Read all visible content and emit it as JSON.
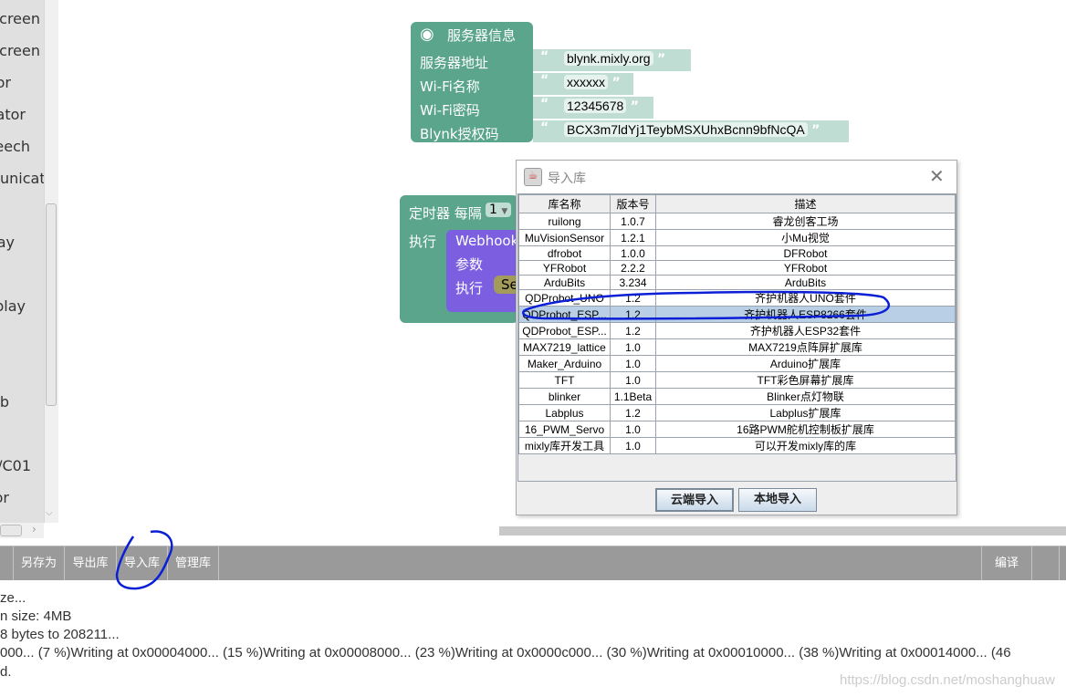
{
  "sidebar": {
    "items": [
      "creen",
      "creen",
      "or",
      "ator",
      "eech",
      "unicate",
      "ay",
      "play",
      "b",
      "/C01",
      "or"
    ]
  },
  "server_block": {
    "title": "服务器信息",
    "rows": [
      {
        "label": "服务器地址",
        "value": "blynk.mixly.org"
      },
      {
        "label": "Wi-Fi名称",
        "value": "xxxxxx"
      },
      {
        "label": "Wi-Fi密码",
        "value": "12345678"
      },
      {
        "label": "Blynk授权码",
        "value": "BCX3m7ldYj1TeybMSXUhxBcnn9bfNcQA"
      }
    ]
  },
  "timer_block": {
    "label": "定时器 每隔",
    "interval": "1",
    "do": "执行",
    "webhook": {
      "title": "Webhook",
      "params": "参数",
      "do": "执行",
      "inner": "Se"
    }
  },
  "dialog": {
    "title": "导入库",
    "columns": [
      "库名称",
      "版本号",
      "描述"
    ],
    "rows": [
      [
        "ruilong",
        "1.0.7",
        "睿龙创客工场"
      ],
      [
        "MuVisionSensor",
        "1.2.1",
        "小Mu视觉"
      ],
      [
        "dfrobot",
        "1.0.0",
        "DFRobot"
      ],
      [
        "YFRobot",
        "2.2.2",
        "YFRobot"
      ],
      [
        "ArduBits",
        "3.234",
        "ArduBits"
      ],
      [
        "QDProbot_UNO",
        "1.2",
        "齐护机器人UNO套件"
      ],
      [
        "QDProbot_ESP...",
        "1.2",
        "齐护机器人ESP8266套件"
      ],
      [
        "QDProbot_ESP...",
        "1.2",
        "齐护机器人ESP32套件"
      ],
      [
        "MAX7219_lattice",
        "1.0",
        "MAX7219点阵屏扩展库"
      ],
      [
        "Maker_Arduino",
        "1.0",
        "Arduino扩展库"
      ],
      [
        "TFT",
        "1.0",
        "TFT彩色屏幕扩展库"
      ],
      [
        "blinker",
        "1.1Beta",
        "Blinker点灯物联"
      ],
      [
        "Labplus",
        "1.2",
        "Labplus扩展库"
      ],
      [
        "16_PWM_Servo",
        "1.0",
        "16路PWM舵机控制板扩展库"
      ],
      [
        "mixly库开发工具",
        "1.0",
        "可以开发mixly库的库"
      ]
    ],
    "selected_row": 6,
    "cloud_import": "云端导入",
    "local_import": "本地导入"
  },
  "toolbar": {
    "cut": "存",
    "save_as": "另存为",
    "export": "导出库",
    "import": "导入库",
    "manage": "管理库",
    "compile": "编译"
  },
  "console": {
    "lines": [
      "ze...",
      "n size: 4MB",
      "8 bytes to 208211...",
      "000... (7 %)Writing at 0x00004000... (15 %)Writing at 0x00008000... (23 %)Writing at 0x0000c000... (30 %)Writing at 0x00010000... (38 %)Writing at 0x00014000... (46",
      "d."
    ]
  },
  "watermark": "https://blog.csdn.net/moshanghuaw",
  "colors": {
    "block_green": "#5ba58c",
    "block_purple": "#7b5fe0",
    "selection": "#b8cfe5",
    "annotation": "#0a1fd6"
  }
}
